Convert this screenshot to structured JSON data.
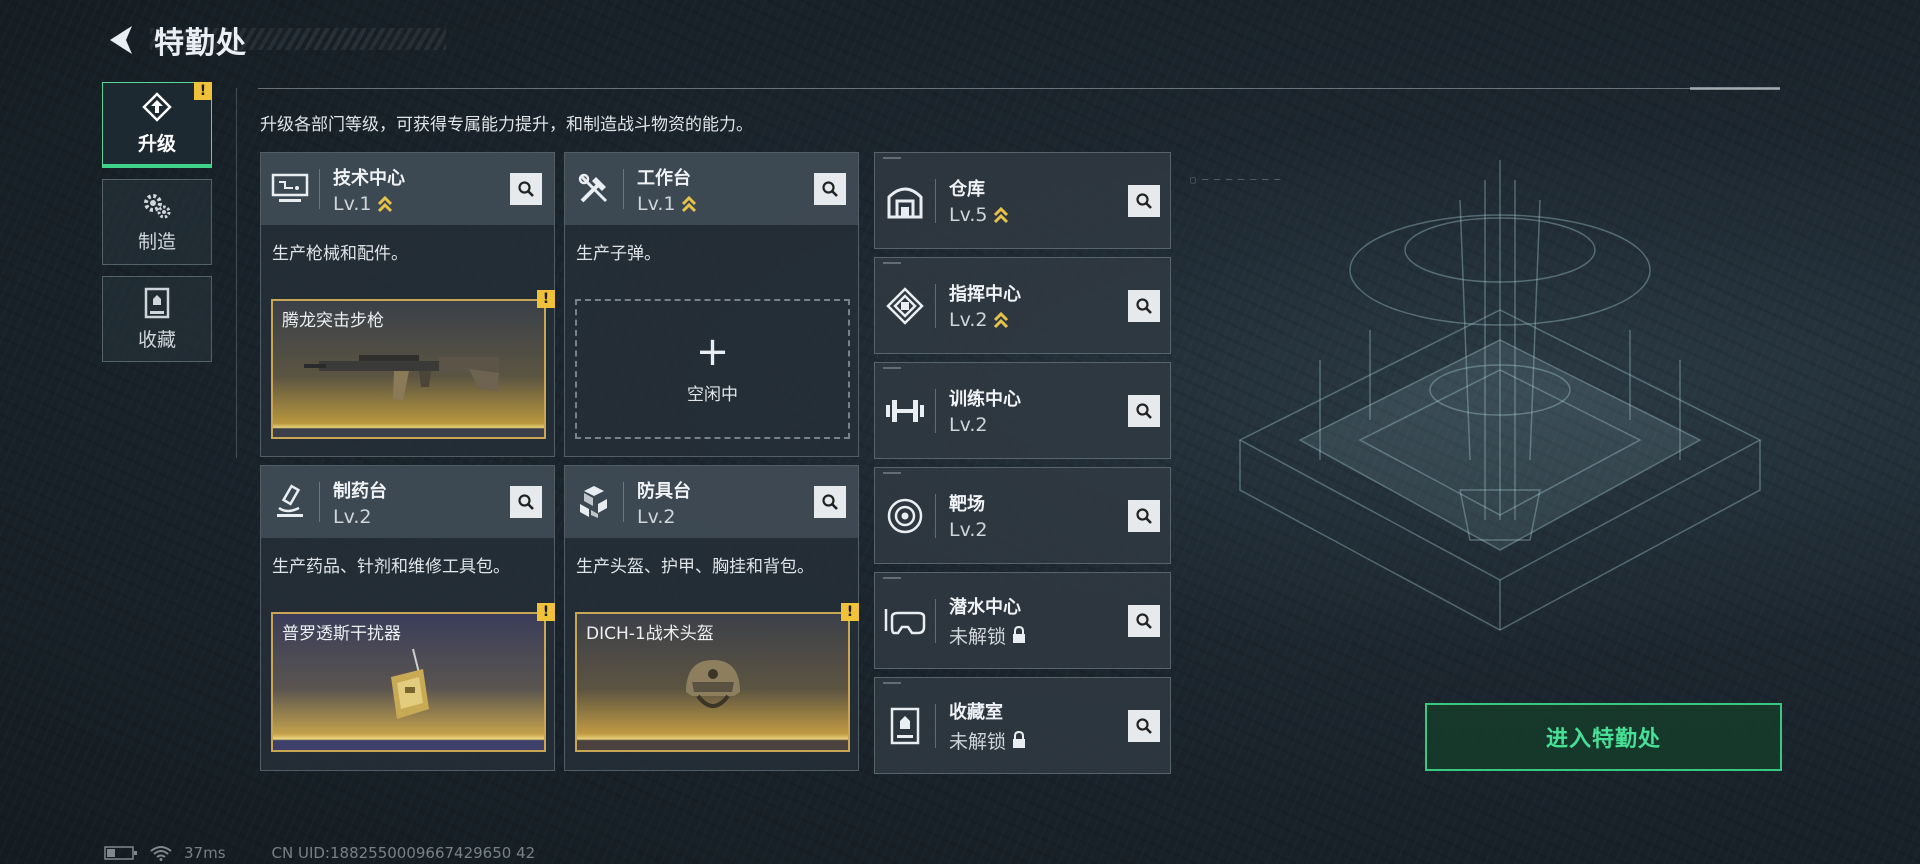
{
  "header": {
    "title": "特勤处"
  },
  "nav": {
    "items": [
      {
        "label": "升级",
        "active": true,
        "alert": "!"
      },
      {
        "label": "制造",
        "active": false
      },
      {
        "label": "收藏",
        "active": false
      }
    ]
  },
  "description": "升级各部门等级，可获得专属能力提升，和制造战斗物资的能力。",
  "departments": [
    {
      "name": "技术中心",
      "level": "Lv.1",
      "desc": "生产枪械和配件。",
      "slot": {
        "item": "腾龙突击步枪",
        "alert": "!"
      }
    },
    {
      "name": "工作台",
      "level": "Lv.1",
      "desc": "生产子弹。",
      "slot": {
        "empty_label": "空闲中",
        "plus": "+"
      }
    },
    {
      "name": "制药台",
      "level": "Lv.2",
      "desc": "生产药品、针剂和维修工具包。",
      "slot": {
        "item": "普罗透斯干扰器",
        "alert": "!"
      }
    },
    {
      "name": "防具台",
      "level": "Lv.2",
      "desc": "生产头盔、护甲、胸挂和背包。",
      "slot": {
        "item": "DICH-1战术头盔",
        "alert": "!"
      }
    }
  ],
  "facilities": [
    {
      "name": "仓库",
      "level": "Lv.5",
      "upgradable": true
    },
    {
      "name": "指挥中心",
      "level": "Lv.2",
      "upgradable": true
    },
    {
      "name": "训练中心",
      "level": "Lv.2",
      "upgradable": false
    },
    {
      "name": "靶场",
      "level": "Lv.2",
      "upgradable": false
    },
    {
      "name": "潜水中心",
      "level": "未解锁",
      "locked": true
    },
    {
      "name": "收藏室",
      "level": "未解锁",
      "locked": true
    }
  ],
  "enter_button": "进入特勤处",
  "footer": {
    "ping": "37ms",
    "uid": "CN UID:1882550009667429650 42"
  },
  "colors": {
    "accent_green": "#3fd38a",
    "alert_yellow": "#f0c23a",
    "level_chevron": "#e6c24a"
  }
}
